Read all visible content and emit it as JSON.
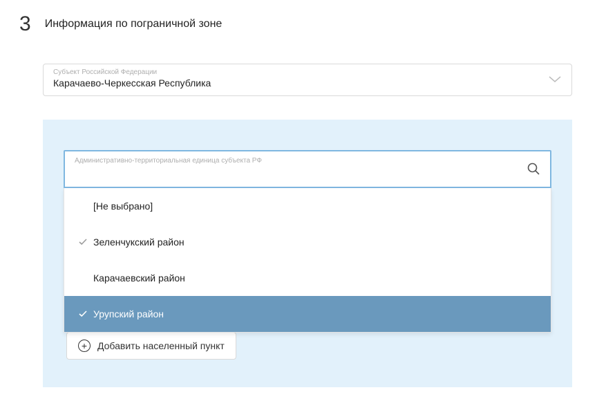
{
  "step": {
    "number": "3",
    "title": "Информация по пограничной зоне"
  },
  "subject": {
    "label": "Субъект Российской Федерации",
    "value": "Карачаево-Черкесская Республика"
  },
  "admin_unit": {
    "label": "Административно-территориальная единица субъекта РФ",
    "search_value": ""
  },
  "dropdown": {
    "items": [
      {
        "label": "[Не выбрано]",
        "checked": false,
        "highlight": false
      },
      {
        "label": "Зеленчукский район",
        "checked": true,
        "highlight": false
      },
      {
        "label": "Карачаевский район",
        "checked": false,
        "highlight": false
      },
      {
        "label": "Урупский район",
        "checked": true,
        "highlight": true
      }
    ]
  },
  "add_button": {
    "label": "Добавить населенный пункт"
  }
}
